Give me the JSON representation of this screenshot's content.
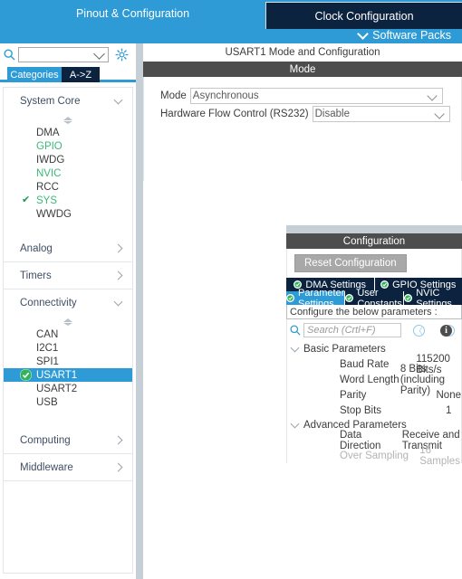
{
  "topbar": {
    "tabs": [
      {
        "label": "Pinout & Configuration",
        "active": true
      },
      {
        "label": "Clock Configuration",
        "active": false
      }
    ],
    "software_packs": "Software Packs",
    "chevron_icon": "chevron-down-icon",
    "accent_blue": "#2e9bd6",
    "dark_navy": "#0c2340"
  },
  "sidebar": {
    "search": {
      "value": "",
      "placeholder": ""
    },
    "search_icon": "search-icon",
    "gear_icon": "gear-icon",
    "view_tabs": [
      {
        "label": "Categories",
        "active": true
      },
      {
        "label": "A->Z",
        "active": false
      }
    ],
    "groups": [
      {
        "label": "System Core",
        "expanded": true,
        "items": [
          {
            "label": "DMA",
            "state": "normal",
            "checked": false
          },
          {
            "label": "GPIO",
            "state": "green",
            "checked": false
          },
          {
            "label": "IWDG",
            "state": "normal",
            "checked": false
          },
          {
            "label": "NVIC",
            "state": "green",
            "checked": false
          },
          {
            "label": "RCC",
            "state": "normal",
            "checked": false
          },
          {
            "label": "SYS",
            "state": "green",
            "checked": true
          },
          {
            "label": "WWDG",
            "state": "normal",
            "checked": false
          }
        ]
      },
      {
        "label": "Analog",
        "expanded": false,
        "items": []
      },
      {
        "label": "Timers",
        "expanded": false,
        "items": []
      },
      {
        "label": "Connectivity",
        "expanded": true,
        "items": [
          {
            "label": "CAN",
            "state": "normal",
            "checked": false
          },
          {
            "label": "I2C1",
            "state": "normal",
            "checked": false
          },
          {
            "label": "SPI1",
            "state": "normal",
            "checked": false
          },
          {
            "label": "USART1",
            "state": "selected",
            "checked": true
          },
          {
            "label": "USART2",
            "state": "normal",
            "checked": false
          },
          {
            "label": "USB",
            "state": "normal",
            "checked": false
          }
        ]
      },
      {
        "label": "Computing",
        "expanded": false,
        "items": []
      },
      {
        "label": "Middleware",
        "expanded": false,
        "items": []
      }
    ]
  },
  "main": {
    "panel_title": "USART1 Mode and Configuration",
    "mode_section": {
      "header": "Mode",
      "fields": [
        {
          "label": "Mode",
          "value": "Asynchronous"
        },
        {
          "label": "Hardware Flow Control (RS232)",
          "value": "Disable"
        }
      ]
    },
    "configuration_section": {
      "header": "Configuration",
      "reset_button": "Reset Configuration",
      "tabs_row1": [
        {
          "label": "DMA Settings",
          "active": false
        },
        {
          "label": "GPIO Settings",
          "active": false
        }
      ],
      "tabs_row2": [
        {
          "label": "Parameter Settings",
          "active": true
        },
        {
          "label": "User Constants",
          "active": false
        },
        {
          "label": "NVIC Settings",
          "active": false
        }
      ],
      "configure_hint": "Configure the below parameters :",
      "search": {
        "value": "",
        "placeholder": "Search (Crtl+F)"
      },
      "search_icon": "search-icon",
      "prev_icon": "chevron-left-circle-icon",
      "next_icon": "chevron-right-circle-icon",
      "info_icon": "info-icon",
      "groups": [
        {
          "label": "Basic Parameters",
          "expanded": true,
          "rows": [
            {
              "name": "Baud Rate",
              "value": "115200 Bits/s",
              "disabled": false
            },
            {
              "name": "Word Length",
              "value": "8 Bits (including Parity)",
              "disabled": false
            },
            {
              "name": "Parity",
              "value": "None",
              "disabled": false
            },
            {
              "name": "Stop Bits",
              "value": "1",
              "disabled": false
            }
          ]
        },
        {
          "label": "Advanced Parameters",
          "expanded": true,
          "rows": [
            {
              "name": "Data Direction",
              "value": "Receive and Transmit",
              "disabled": false
            },
            {
              "name": "Over Sampling",
              "value": "16 Samples",
              "disabled": true
            }
          ]
        }
      ]
    }
  }
}
